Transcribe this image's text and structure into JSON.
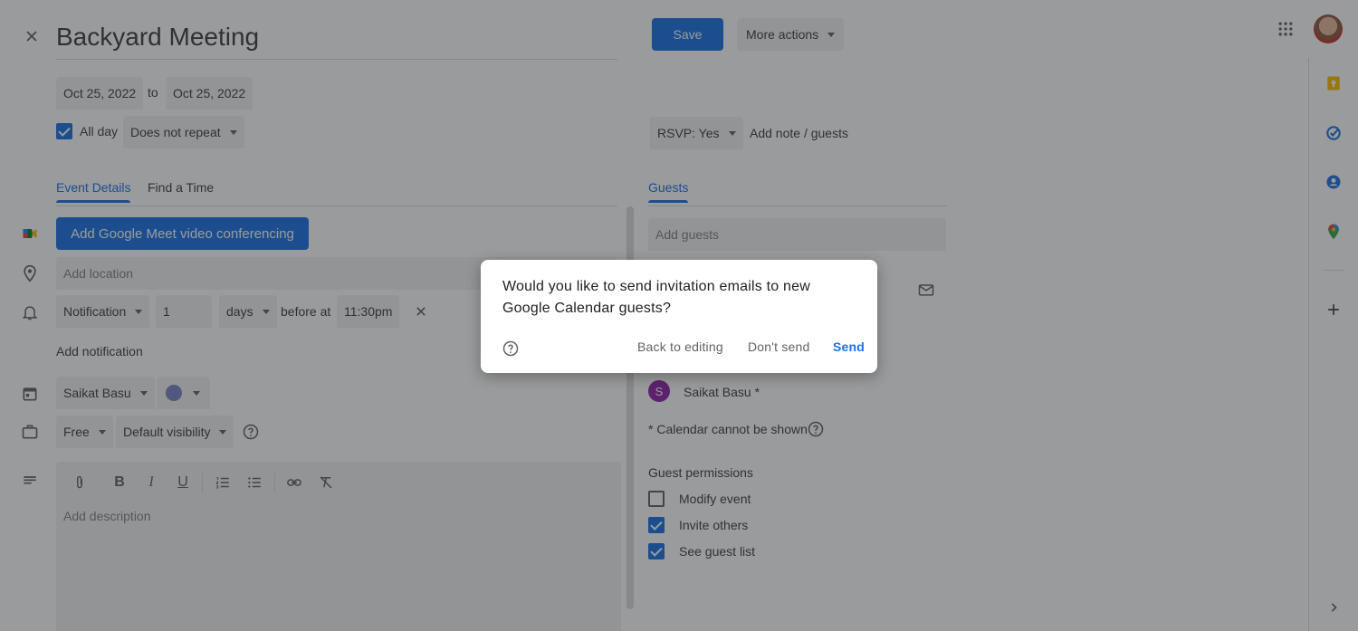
{
  "event": {
    "title": "Backyard Meeting",
    "start_date": "Oct 25, 2022",
    "to_label": "to",
    "end_date": "Oct 25, 2022",
    "all_day_label": "All day",
    "repeat": "Does not repeat"
  },
  "toolbar": {
    "save_label": "Save",
    "more_actions_label": "More actions"
  },
  "rsvp": {
    "value": "RSVP: Yes",
    "add_note_label": "Add note / guests"
  },
  "tabs": {
    "event_details": "Event Details",
    "find_time": "Find a Time",
    "guests": "Guests"
  },
  "details": {
    "meet_button": "Add Google Meet video conferencing",
    "location_placeholder": "Add location",
    "notification_type": "Notification",
    "notification_value": "1",
    "notification_unit": "days",
    "before_at_label": "before at",
    "notification_time": "11:30pm",
    "add_notification": "Add notification",
    "calendar_owner": "Saikat Basu",
    "calendar_color": "#7986cb",
    "availability": "Free",
    "visibility": "Default visibility",
    "description_placeholder": "Add description"
  },
  "guests": {
    "add_placeholder": "Add guests",
    "guest_initial": "S",
    "guest_name": "Saikat Basu *",
    "guest_color": "#8e24aa",
    "calendar_note": "* Calendar cannot be shown",
    "permissions_title": "Guest permissions",
    "permissions": [
      {
        "label": "Modify event",
        "checked": false
      },
      {
        "label": "Invite others",
        "checked": true
      },
      {
        "label": "See guest list",
        "checked": true
      }
    ]
  },
  "dialog": {
    "message": "Would you like to send invitation emails to new Google Calendar guests?",
    "back_label": "Back to editing",
    "dont_send_label": "Don't send",
    "send_label": "Send"
  },
  "colors": {
    "accent": "#1a73e8",
    "field_bg": "#f1f3f4"
  }
}
